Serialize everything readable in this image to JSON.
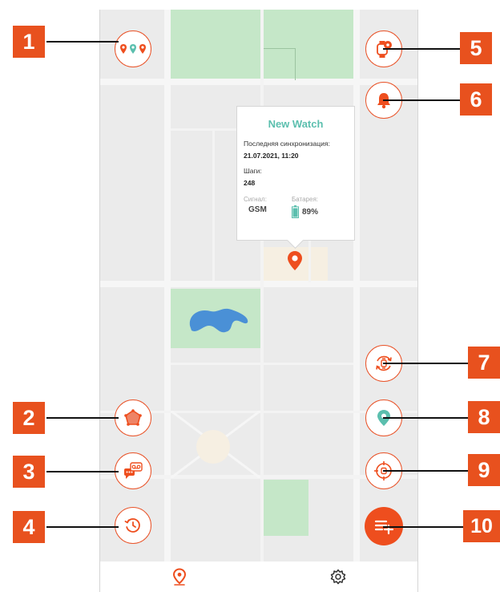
{
  "popup": {
    "title": "New Watch",
    "last_sync_label": "Последняя синхронизация:",
    "last_sync_value": "21.07.2021, 11:20",
    "steps_label": "Шаги:",
    "steps_value": "248",
    "signal_label": "Сигнал:",
    "signal_value": "GSM",
    "battery_label": "Батарея:",
    "battery_value": "89%"
  },
  "callouts": [
    "1",
    "2",
    "3",
    "4",
    "5",
    "6",
    "7",
    "8",
    "9",
    "10"
  ],
  "bottom_nav": {
    "items": [
      "map-tab",
      "settings-tab"
    ],
    "active": "map-tab"
  },
  "colors": {
    "accent": "#ee4e1e",
    "teal": "#5bbfae",
    "map_bg": "#ebebeb",
    "park": "#c5e7c8"
  }
}
